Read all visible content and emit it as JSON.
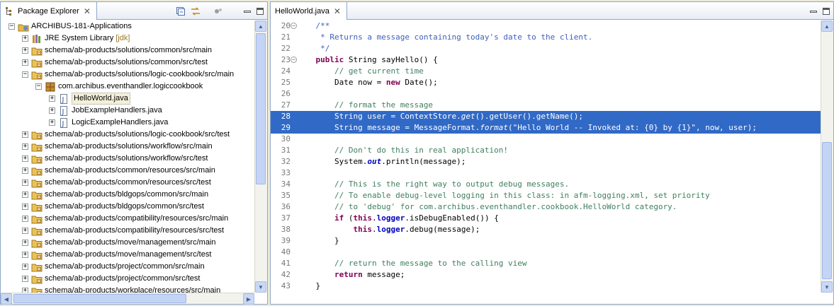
{
  "left_panel": {
    "title": "Package Explorer",
    "close_glyph": "✕",
    "toolbar": {
      "collapse_all_icon": "collapse-all-icon",
      "link_editor_icon": "link-with-editor-icon",
      "view_menu_icon": "view-menu-icon",
      "minimize_icon": "minimize-icon",
      "maximize_icon": "maximize-icon"
    },
    "tree": [
      {
        "label": "ARCHIBUS-181-Applications",
        "deco": "",
        "depth": 0,
        "expander": "−",
        "icon": "project-icon"
      },
      {
        "label": "JRE System Library",
        "deco": "[jdk]",
        "depth": 1,
        "expander": "+",
        "icon": "library-icon"
      },
      {
        "label": "schema/ab-products/solutions/common/src/main",
        "deco": "",
        "depth": 1,
        "expander": "+",
        "icon": "source-folder-icon"
      },
      {
        "label": "schema/ab-products/solutions/common/src/test",
        "deco": "",
        "depth": 1,
        "expander": "+",
        "icon": "source-folder-icon"
      },
      {
        "label": "schema/ab-products/solutions/logic-cookbook/src/main",
        "deco": "",
        "depth": 1,
        "expander": "−",
        "icon": "source-folder-icon"
      },
      {
        "label": "com.archibus.eventhandler.logiccookbook",
        "deco": "",
        "depth": 2,
        "expander": "−",
        "icon": "package-icon"
      },
      {
        "label": "HelloWorld.java",
        "deco": "",
        "depth": 3,
        "expander": "+",
        "icon": "java-file-icon",
        "selected": true
      },
      {
        "label": "JobExampleHandlers.java",
        "deco": "",
        "depth": 3,
        "expander": "+",
        "icon": "java-file-icon"
      },
      {
        "label": "LogicExampleHandlers.java",
        "deco": "",
        "depth": 3,
        "expander": "+",
        "icon": "java-file-icon"
      },
      {
        "label": "schema/ab-products/solutions/logic-cookbook/src/test",
        "deco": "",
        "depth": 1,
        "expander": "+",
        "icon": "source-folder-icon"
      },
      {
        "label": "schema/ab-products/solutions/workflow/src/main",
        "deco": "",
        "depth": 1,
        "expander": "+",
        "icon": "source-folder-icon"
      },
      {
        "label": "schema/ab-products/solutions/workflow/src/test",
        "deco": "",
        "depth": 1,
        "expander": "+",
        "icon": "source-folder-icon"
      },
      {
        "label": "schema/ab-products/common/resources/src/main",
        "deco": "",
        "depth": 1,
        "expander": "+",
        "icon": "source-folder-icon"
      },
      {
        "label": "schema/ab-products/common/resources/src/test",
        "deco": "",
        "depth": 1,
        "expander": "+",
        "icon": "source-folder-icon"
      },
      {
        "label": "schema/ab-products/bldgops/common/src/main",
        "deco": "",
        "depth": 1,
        "expander": "+",
        "icon": "source-folder-icon"
      },
      {
        "label": "schema/ab-products/bldgops/common/src/test",
        "deco": "",
        "depth": 1,
        "expander": "+",
        "icon": "source-folder-icon"
      },
      {
        "label": "schema/ab-products/compatibility/resources/src/main",
        "deco": "",
        "depth": 1,
        "expander": "+",
        "icon": "source-folder-icon"
      },
      {
        "label": "schema/ab-products/compatibility/resources/src/test",
        "deco": "",
        "depth": 1,
        "expander": "+",
        "icon": "source-folder-icon"
      },
      {
        "label": "schema/ab-products/move/management/src/main",
        "deco": "",
        "depth": 1,
        "expander": "+",
        "icon": "source-folder-icon"
      },
      {
        "label": "schema/ab-products/move/management/src/test",
        "deco": "",
        "depth": 1,
        "expander": "+",
        "icon": "source-folder-icon"
      },
      {
        "label": "schema/ab-products/project/common/src/main",
        "deco": "",
        "depth": 1,
        "expander": "+",
        "icon": "source-folder-icon"
      },
      {
        "label": "schema/ab-products/project/common/src/test",
        "deco": "",
        "depth": 1,
        "expander": "+",
        "icon": "source-folder-icon"
      },
      {
        "label": "schema/ab-products/workplace/resources/src/main",
        "deco": "",
        "depth": 1,
        "expander": "+",
        "icon": "source-folder-icon"
      }
    ]
  },
  "editor": {
    "tab_title": "HelloWorld.java",
    "close_glyph": "✕",
    "fold_glyph": "−",
    "lines": [
      {
        "n": "20",
        "fold": true,
        "indent": "    ",
        "tokens": [
          {
            "t": "/**",
            "c": "jd"
          }
        ]
      },
      {
        "n": "21",
        "indent": "     ",
        "tokens": [
          {
            "t": "* Returns a message containing today's date to the client.",
            "c": "jd"
          }
        ]
      },
      {
        "n": "22",
        "indent": "     ",
        "tokens": [
          {
            "t": "*/",
            "c": "jd"
          }
        ]
      },
      {
        "n": "23",
        "fold": true,
        "indent": "    ",
        "tokens": [
          {
            "t": "public",
            "c": "kw"
          },
          {
            "t": " String sayHello() {",
            "c": ""
          }
        ]
      },
      {
        "n": "24",
        "indent": "        ",
        "tokens": [
          {
            "t": "// get current time",
            "c": "cm"
          }
        ]
      },
      {
        "n": "25",
        "indent": "        ",
        "tokens": [
          {
            "t": "Date now = ",
            "c": ""
          },
          {
            "t": "new",
            "c": "kw"
          },
          {
            "t": " Date();",
            "c": ""
          }
        ]
      },
      {
        "n": "26",
        "indent": "",
        "tokens": []
      },
      {
        "n": "27",
        "indent": "        ",
        "tokens": [
          {
            "t": "// format the message",
            "c": "cm"
          }
        ]
      },
      {
        "n": "28",
        "hl": true,
        "indent": "        ",
        "tokens": [
          {
            "t": "String user = ContextStore.",
            "c": ""
          },
          {
            "t": "get",
            "c": "it"
          },
          {
            "t": "().getUser().getName();",
            "c": ""
          }
        ]
      },
      {
        "n": "29",
        "hl": true,
        "indent": "        ",
        "tokens": [
          {
            "t": "String message = MessageFormat.",
            "c": ""
          },
          {
            "t": "format",
            "c": "it"
          },
          {
            "t": "(\"Hello World -- Invoked at: {0} by {1}\", now, user);",
            "c": ""
          }
        ]
      },
      {
        "n": "30",
        "indent": "",
        "tokens": []
      },
      {
        "n": "31",
        "indent": "        ",
        "tokens": [
          {
            "t": "// Don't do this in real application!",
            "c": "cm"
          }
        ]
      },
      {
        "n": "32",
        "indent": "        ",
        "tokens": [
          {
            "t": "System.",
            "c": ""
          },
          {
            "t": "out",
            "c": "it fdi"
          },
          {
            "t": ".println(message);",
            "c": ""
          }
        ]
      },
      {
        "n": "33",
        "indent": "",
        "tokens": []
      },
      {
        "n": "34",
        "indent": "        ",
        "tokens": [
          {
            "t": "// This is the right way to output debug messages.",
            "c": "cm"
          }
        ]
      },
      {
        "n": "35",
        "indent": "        ",
        "tokens": [
          {
            "t": "// To enable debug-level logging in this class: in afm-logging.xml, set priority",
            "c": "cm"
          }
        ]
      },
      {
        "n": "36",
        "indent": "        ",
        "tokens": [
          {
            "t": "// to 'debug' for com.archibus.eventhandler.cookbook.HelloWorld category.",
            "c": "cm"
          }
        ]
      },
      {
        "n": "37",
        "indent": "        ",
        "tokens": [
          {
            "t": "if",
            "c": "kw"
          },
          {
            "t": " (",
            "c": ""
          },
          {
            "t": "this",
            "c": "kw"
          },
          {
            "t": ".",
            "c": ""
          },
          {
            "t": "logger",
            "c": "fd"
          },
          {
            "t": ".isDebugEnabled()) {",
            "c": ""
          }
        ]
      },
      {
        "n": "38",
        "indent": "            ",
        "tokens": [
          {
            "t": "this",
            "c": "kw"
          },
          {
            "t": ".",
            "c": ""
          },
          {
            "t": "logger",
            "c": "fd"
          },
          {
            "t": ".debug(message);",
            "c": ""
          }
        ]
      },
      {
        "n": "39",
        "indent": "        ",
        "tokens": [
          {
            "t": "}",
            "c": ""
          }
        ]
      },
      {
        "n": "40",
        "indent": "",
        "tokens": []
      },
      {
        "n": "41",
        "indent": "        ",
        "tokens": [
          {
            "t": "// return the message to the calling view",
            "c": "cm"
          }
        ]
      },
      {
        "n": "42",
        "indent": "        ",
        "tokens": [
          {
            "t": "return",
            "c": "kw"
          },
          {
            "t": " message;",
            "c": ""
          }
        ]
      },
      {
        "n": "43",
        "indent": "    ",
        "tokens": [
          {
            "t": "}",
            "c": ""
          }
        ]
      }
    ]
  },
  "colors": {
    "selection": "#3169c6",
    "keyword": "#7f0055",
    "comment": "#3f7f5f",
    "javadoc": "#3f5fbf",
    "string": "#2a00ff",
    "field": "#0000c0",
    "frame": "#8fa7c9"
  }
}
